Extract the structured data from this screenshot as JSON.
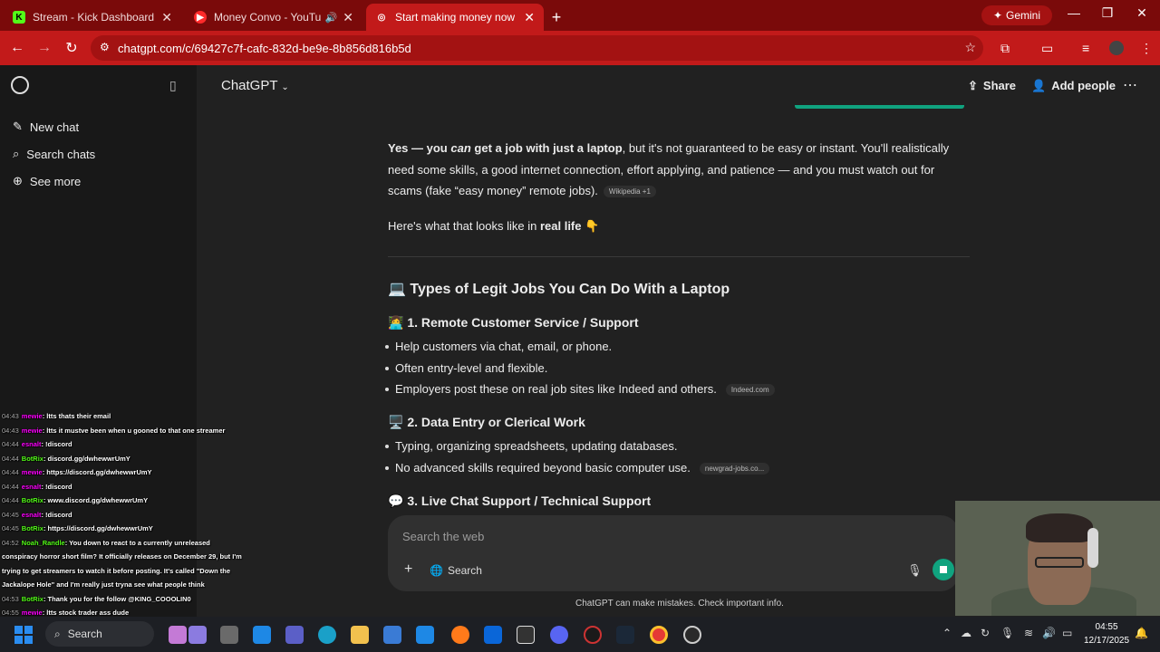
{
  "browser": {
    "tabs": [
      {
        "title": "Stream - Kick Dashboard",
        "favicon": "K"
      },
      {
        "title": "Money Convo - YouTube M",
        "favicon": "▶"
      },
      {
        "title": "Start making money now",
        "favicon": "◎"
      }
    ],
    "gemini_label": "Gemini",
    "url": "chatgpt.com/c/69427c7f-cafc-832d-be9e-8b856d816b5d",
    "colors": {
      "frame": "#7a0a0a",
      "toolbar": "#c21a1a"
    }
  },
  "sidebar": {
    "items": [
      {
        "label": "New chat",
        "icon": "pencil-icon"
      },
      {
        "label": "Search chats",
        "icon": "search-icon"
      },
      {
        "label": "See more",
        "icon": "plus-circle-icon"
      }
    ]
  },
  "header": {
    "title": "ChatGPT",
    "share": "Share",
    "add_people": "Add people"
  },
  "message": {
    "p1_bold": "Yes — you",
    "p1_italic": "can",
    "p1_bold2": "get a job with just a laptop",
    "p1_rest": ", but it's not guaranteed to be easy or instant. You'll realistically need some skills, a good internet connection, effort applying, and patience — and you must watch out for scams (fake “easy money” remote jobs).",
    "p1_cite": "Wikipedia +1",
    "p2_pre": "Here's what that looks like in",
    "p2_bold": "real life",
    "p2_emoji": "👇",
    "h2": "💻 Types of Legit Jobs You Can Do With a Laptop",
    "s1_title": "👩‍💻 1. Remote Customer Service / Support",
    "s1_items": [
      "Help customers via chat, email, or phone.",
      "Often entry-level and flexible.",
      "Employers post these on real job sites like Indeed and others."
    ],
    "s1_cite": "Indeed.com",
    "s2_title": "🖥️ 2. Data Entry or Clerical Work",
    "s2_items": [
      "Typing, organizing spreadsheets, updating databases.",
      "No advanced skills required beyond basic computer use."
    ],
    "s2_cite": "newgrad-jobs.co...",
    "s3_title": "💬 3. Live Chat Support / Technical Support"
  },
  "composer": {
    "placeholder": "Search the web",
    "search_label": "Search",
    "footnote": "ChatGPT can make mistakes. Check important info."
  },
  "chat_overlay": [
    {
      "time": "04:43",
      "user": "mewie",
      "text": ": ltts thats their email"
    },
    {
      "time": "04:43",
      "user": "mewie",
      "text": ": ltts it mustve been when u gooned to that one streamer"
    },
    {
      "time": "04:44",
      "user": "esnalt",
      "text": ": !discord"
    },
    {
      "time": "04:44",
      "user": "BotRix",
      "text": ": discord.gg/dwhewwrUmY"
    },
    {
      "time": "04:44",
      "user": "mewie",
      "text": ": https://discord.gg/dwhewwrUmY"
    },
    {
      "time": "04:44",
      "user": "esnalt",
      "text": ": !discord"
    },
    {
      "time": "04:44",
      "user": "BotRix",
      "text": ": www.discord.gg/dwhewwrUmY"
    },
    {
      "time": "04:45",
      "user": "esnalt",
      "text": ": !discord"
    },
    {
      "time": "04:45",
      "user": "BotRix",
      "text": ": https://discord.gg/dwhewwrUmY"
    },
    {
      "time": "04:52",
      "user": "Noah_Randle",
      "text": ": You down to react to a currently unreleased"
    },
    {
      "time": "",
      "user": "",
      "text": "conspiracy horror short film? It officially releases on December 29, but I'm"
    },
    {
      "time": "",
      "user": "",
      "text": "trying to get streamers to watch it before posting. It's called \"Down the"
    },
    {
      "time": "",
      "user": "",
      "text": "Jackalope Hole\" and I'm really just tryna see what people think"
    },
    {
      "time": "04:53",
      "user": "BotRix",
      "text": ": Thank you for the follow @KING_COOOLIN0"
    },
    {
      "time": "04:55",
      "user": "mewie",
      "text": ": ltts stock trader ass dude"
    }
  ],
  "taskbar": {
    "search_label": "Search",
    "time": "04:55",
    "date": "12/17/2025"
  }
}
